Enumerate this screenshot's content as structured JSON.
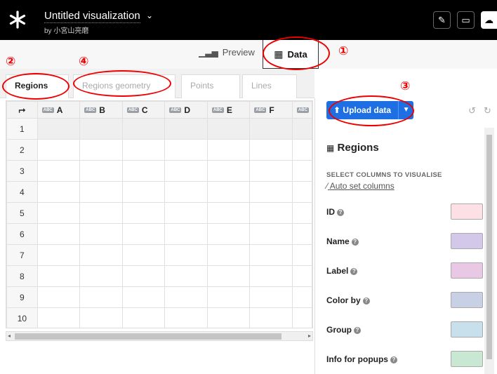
{
  "header": {
    "title": "Untitled visualization",
    "byline": "by 小宮山亮磨"
  },
  "view_tabs": {
    "preview": "Preview",
    "data": "Data"
  },
  "sheet_tabs": [
    "Regions",
    "Regions geometry",
    "Points",
    "Lines"
  ],
  "grid": {
    "columns": [
      "A",
      "B",
      "C",
      "D",
      "E",
      "F"
    ],
    "col_type_badge": "ABC",
    "rows": [
      "1",
      "2",
      "3",
      "4",
      "5",
      "6",
      "7",
      "8",
      "9",
      "10"
    ]
  },
  "panel": {
    "upload_label": "Upload data",
    "title": "Regions",
    "subtitle": "SELECT COLUMNS TO VISUALISE",
    "auto_set": "Auto set columns",
    "fields": [
      {
        "label": "ID",
        "color": "#fde0e6"
      },
      {
        "label": "Name",
        "color": "#d3c8ea"
      },
      {
        "label": "Label",
        "color": "#e9c8e6"
      },
      {
        "label": "Color by",
        "color": "#c8d0e6"
      },
      {
        "label": "Group",
        "color": "#c8dfec"
      },
      {
        "label": "Info for popups",
        "color": "#c9e8d3"
      }
    ]
  },
  "annotations": [
    "①",
    "②",
    "③",
    "④"
  ]
}
